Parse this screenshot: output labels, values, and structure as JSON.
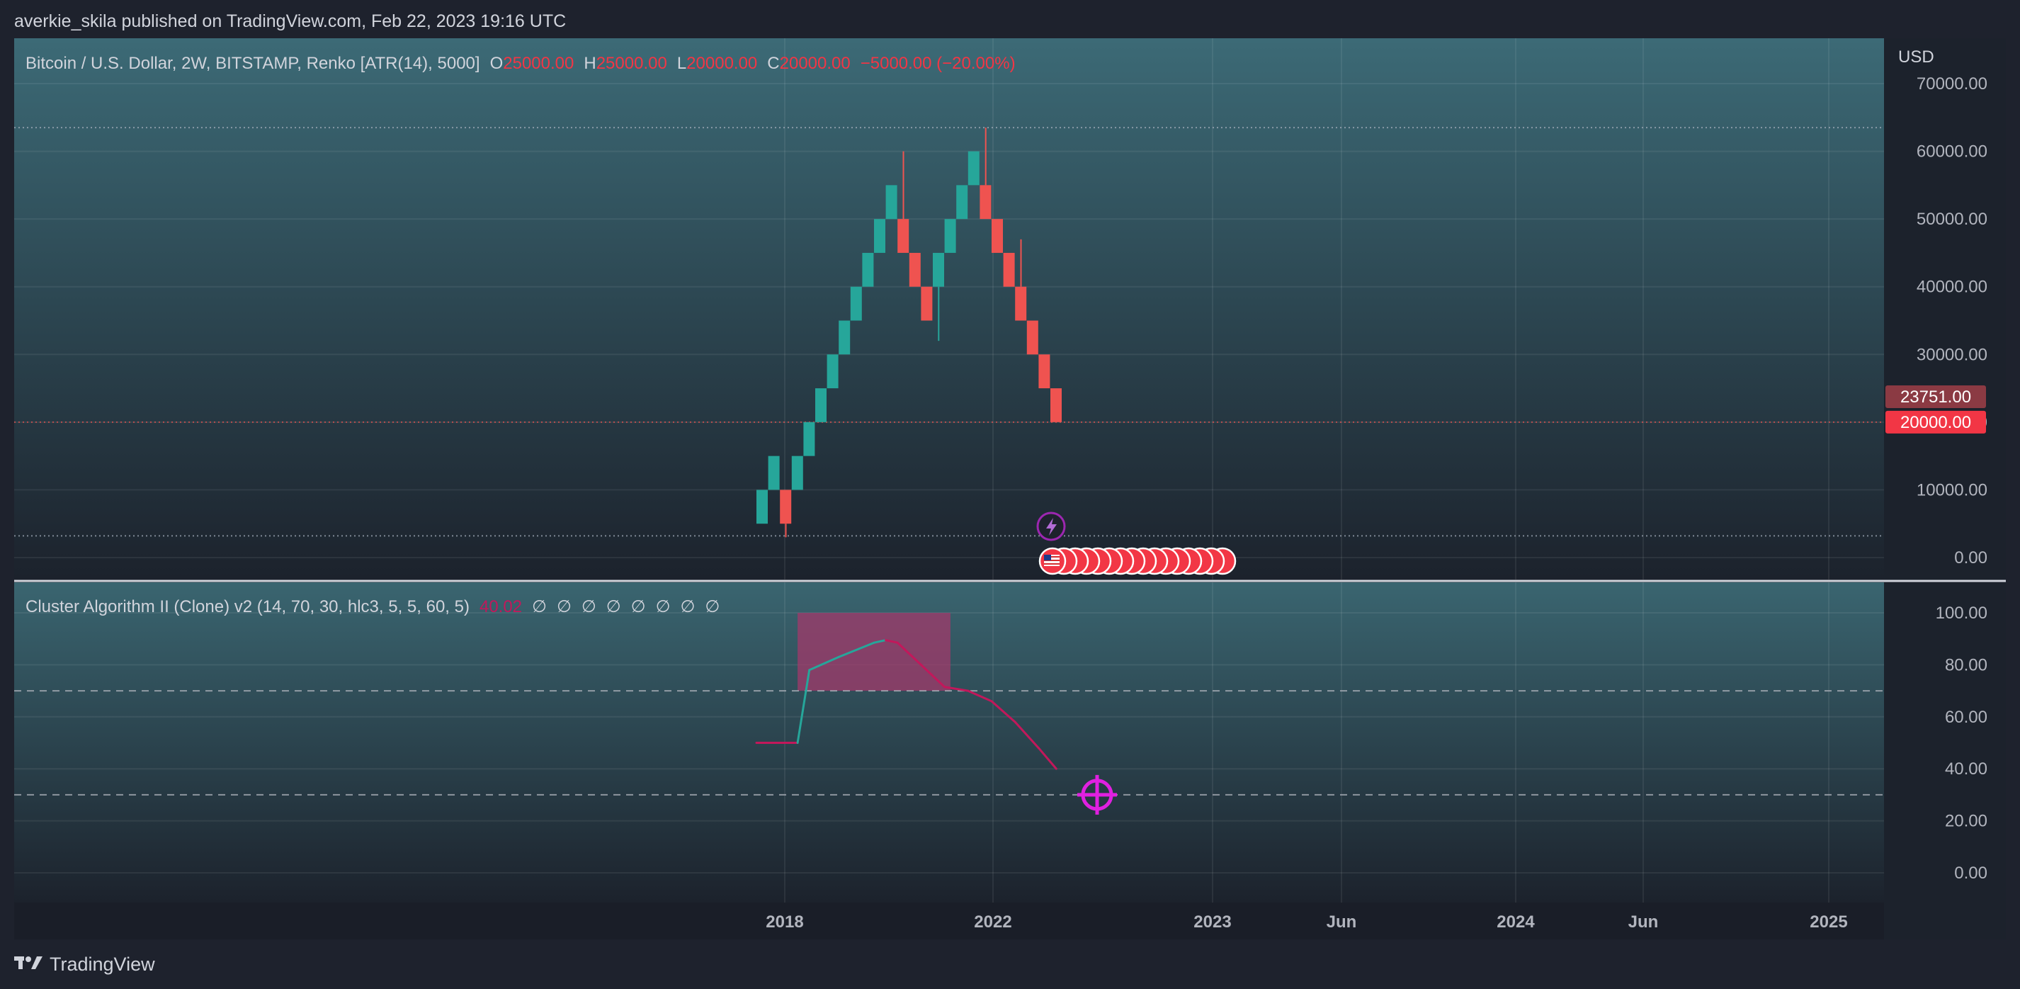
{
  "header": {
    "published_line": "averkie_skila published on TradingView.com, Feb 22, 2023 19:16 UTC"
  },
  "footer": {
    "brand": "TradingView",
    "logo_icon": "tradingview-logo-icon"
  },
  "main_pane": {
    "legend": {
      "symbol": "Bitcoin / U.S. Dollar, 2W, BITSTAMP, Renko [ATR(14), 5000]",
      "o_key": "O",
      "o_val": "25000.00",
      "h_key": "H",
      "h_val": "25000.00",
      "l_key": "L",
      "l_val": "20000.00",
      "c_key": "C",
      "c_val": "20000.00",
      "change": "−5000.00 (−20.00%)"
    },
    "currency": "USD",
    "price_badges": [
      {
        "text": "23751.00",
        "value": 23751,
        "color": "#8b3a43"
      },
      {
        "text": "20000.00",
        "value": 20000,
        "color": "#f23645"
      }
    ],
    "markers": {
      "lightning_icon": "lightning-icon",
      "flag_icon": "us-flag-event-icon",
      "event_count": 16
    }
  },
  "indicator_pane": {
    "legend": {
      "name": "Cluster Algorithm II (Clone) v2 (14, 70, 30, hlc3, 5, 5, 60, 5)",
      "value": "40.02",
      "value_color": "#c2185b",
      "empty_values": [
        "∅",
        "∅",
        "∅",
        "∅",
        "∅",
        "∅",
        "∅",
        "∅"
      ]
    },
    "crosshair_icon": "crosshair-target-icon"
  },
  "colors": {
    "up": "#26a69a",
    "down": "#ef5350",
    "indicator_up": "#26a69a",
    "indicator_down": "#c2185b",
    "crosshair": "#e020e0",
    "zone": "#a23a6b"
  },
  "chart_data": [
    {
      "type": "renko",
      "title": "Bitcoin / U.S. Dollar, 2W, BITSTAMP, Renko [ATR(14), 5000]",
      "ylim": [
        0,
        70000
      ],
      "y_ticks": [
        "70000.00",
        "60000.00",
        "50000.00",
        "40000.00",
        "30000.00",
        "20000.00",
        "10000.00",
        "0.00"
      ],
      "y_tick_values": [
        70000,
        60000,
        50000,
        40000,
        30000,
        20000,
        10000,
        0
      ],
      "x_ticks": [
        "2018",
        "2022",
        "2023",
        "Jun",
        "2024",
        "Jun",
        "2025"
      ],
      "box_size": 5000,
      "bricks": [
        {
          "open": 5000,
          "close": 10000,
          "dir": "up"
        },
        {
          "open": 10000,
          "close": 15000,
          "dir": "up"
        },
        {
          "open": 10000,
          "close": 5000,
          "dir": "down"
        },
        {
          "open": 10000,
          "close": 15000,
          "dir": "up"
        },
        {
          "open": 15000,
          "close": 20000,
          "dir": "up"
        },
        {
          "open": 20000,
          "close": 25000,
          "dir": "up"
        },
        {
          "open": 25000,
          "close": 30000,
          "dir": "up"
        },
        {
          "open": 30000,
          "close": 35000,
          "dir": "up"
        },
        {
          "open": 35000,
          "close": 40000,
          "dir": "up"
        },
        {
          "open": 40000,
          "close": 45000,
          "dir": "up"
        },
        {
          "open": 45000,
          "close": 50000,
          "dir": "up"
        },
        {
          "open": 50000,
          "close": 55000,
          "dir": "up"
        },
        {
          "open": 50000,
          "close": 45000,
          "dir": "down"
        },
        {
          "open": 45000,
          "close": 40000,
          "dir": "down"
        },
        {
          "open": 40000,
          "close": 35000,
          "dir": "down"
        },
        {
          "open": 40000,
          "close": 45000,
          "dir": "up"
        },
        {
          "open": 45000,
          "close": 50000,
          "dir": "up"
        },
        {
          "open": 50000,
          "close": 55000,
          "dir": "up"
        },
        {
          "open": 55000,
          "close": 60000,
          "dir": "up"
        },
        {
          "open": 55000,
          "close": 50000,
          "dir": "down"
        },
        {
          "open": 50000,
          "close": 45000,
          "dir": "down"
        },
        {
          "open": 45000,
          "close": 40000,
          "dir": "down"
        },
        {
          "open": 40000,
          "close": 35000,
          "dir": "down"
        },
        {
          "open": 35000,
          "close": 30000,
          "dir": "down"
        },
        {
          "open": 30000,
          "close": 25000,
          "dir": "down"
        },
        {
          "open": 25000,
          "close": 20000,
          "dir": "down"
        }
      ],
      "wicks": [
        {
          "brick": 2,
          "low": 3000
        },
        {
          "brick": 12,
          "high": 60000
        },
        {
          "brick": 15,
          "low": 32000
        },
        {
          "brick": 19,
          "high": 63500
        },
        {
          "brick": 22,
          "high": 47000
        }
      ],
      "reference_lines": [
        63500,
        3200,
        20000
      ]
    },
    {
      "type": "line",
      "title": "Cluster Algorithm II (Clone) v2 (14, 70, 30, hlc3, 5, 5, 60, 5)",
      "ylim": [
        0,
        100
      ],
      "y_ticks": [
        "100.00",
        "80.00",
        "60.00",
        "40.00",
        "20.00",
        "0.00"
      ],
      "y_tick_values": [
        100,
        80,
        60,
        40,
        20,
        0
      ],
      "levels": [
        70,
        30
      ],
      "zone": {
        "from_bar": 3.5,
        "to_bar": 16.5,
        "low": 70,
        "high": 100
      },
      "series": [
        {
          "values": [
            {
              "bar": 0,
              "y": 50,
              "dir": "down"
            },
            {
              "bar": 3.5,
              "y": 50,
              "dir": "up"
            },
            {
              "bar": 4.5,
              "y": 78,
              "dir": "up"
            },
            {
              "bar": 7,
              "y": 83,
              "dir": "up"
            },
            {
              "bar": 10,
              "y": 88.5,
              "dir": "up"
            },
            {
              "bar": 11,
              "y": 89.5,
              "dir": "down"
            },
            {
              "bar": 12,
              "y": 88.5,
              "dir": "down"
            },
            {
              "bar": 14,
              "y": 80,
              "dir": "down"
            },
            {
              "bar": 16,
              "y": 71.5,
              "dir": "down"
            },
            {
              "bar": 18,
              "y": 70,
              "dir": "down"
            },
            {
              "bar": 20,
              "y": 66,
              "dir": "down"
            },
            {
              "bar": 22,
              "y": 58,
              "dir": "down"
            },
            {
              "bar": 24,
              "y": 48,
              "dir": "down"
            },
            {
              "bar": 25.5,
              "y": 40.02,
              "dir": "down"
            }
          ]
        }
      ]
    }
  ]
}
